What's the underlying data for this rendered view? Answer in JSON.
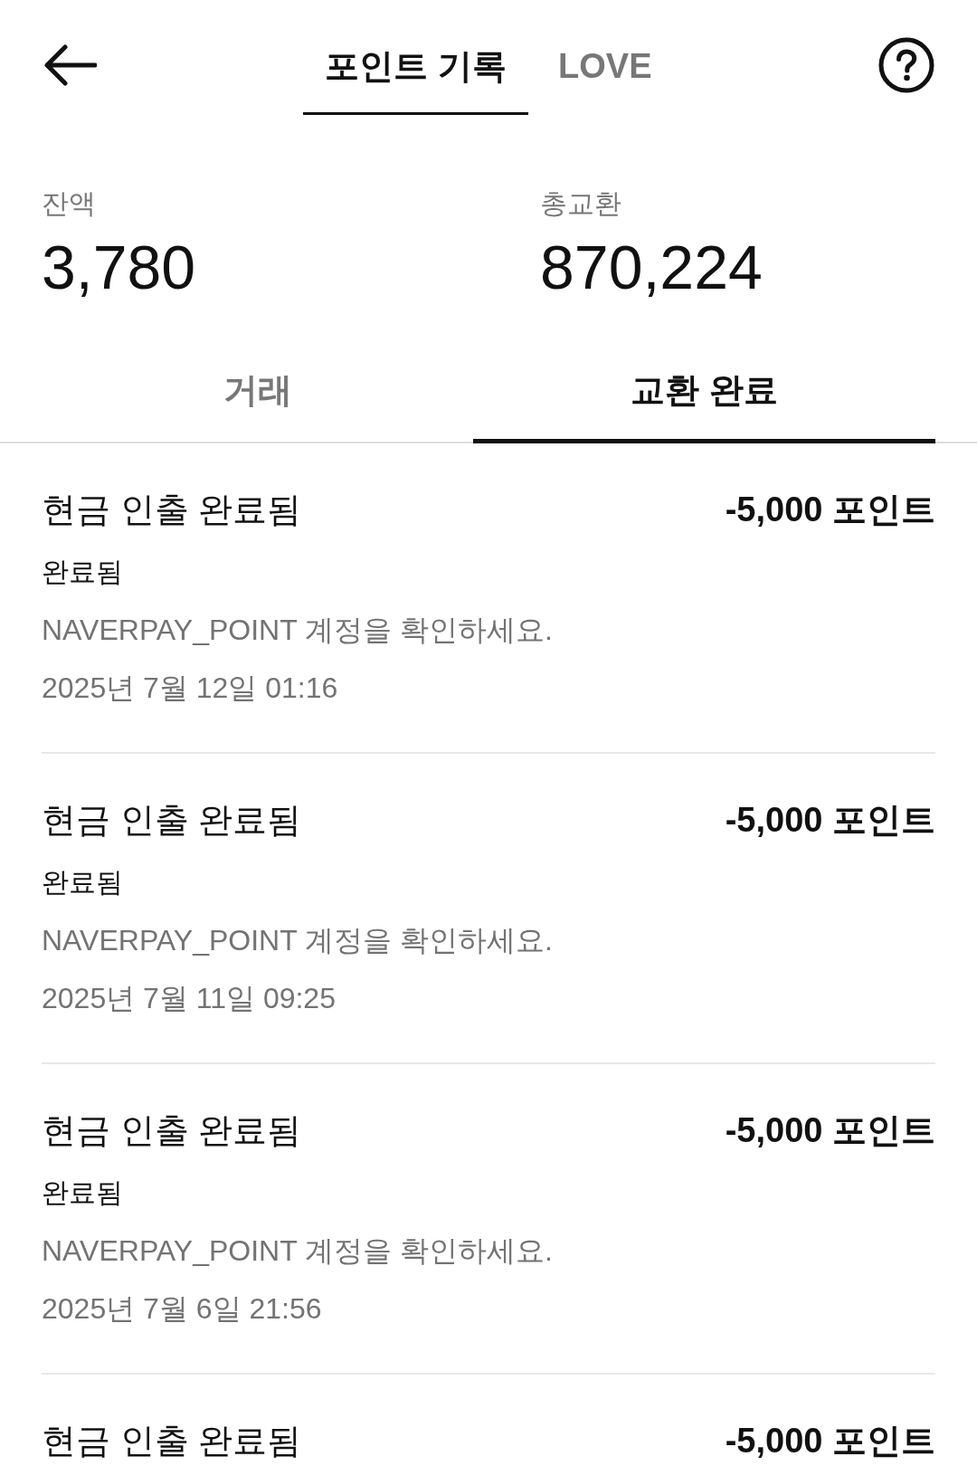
{
  "header": {
    "tabs": [
      {
        "label": "포인트 기록",
        "selected": true
      },
      {
        "label": "LOVE",
        "selected": false
      }
    ]
  },
  "summary": [
    {
      "label": "잔액",
      "value": "3,780"
    },
    {
      "label": "총교환",
      "value": "870,224"
    }
  ],
  "sub_tabs": [
    {
      "label": "거래",
      "selected": false
    },
    {
      "label": "교환 완료",
      "selected": true
    }
  ],
  "transactions": [
    {
      "title": "현금 인출 완료됨",
      "amount": "-5,000 포인트",
      "status": "완료됨",
      "note": "NAVERPAY_POINT 계정을 확인하세요.",
      "date": "2025년 7월 12일 01:16"
    },
    {
      "title": "현금 인출 완료됨",
      "amount": "-5,000 포인트",
      "status": "완료됨",
      "note": "NAVERPAY_POINT 계정을 확인하세요.",
      "date": "2025년 7월 11일 09:25"
    },
    {
      "title": "현금 인출 완료됨",
      "amount": "-5,000 포인트",
      "status": "완료됨",
      "note": "NAVERPAY_POINT 계정을 확인하세요.",
      "date": "2025년 7월 6일 21:56"
    },
    {
      "title": "현금 인출 완료됨",
      "amount": "-5,000 포인트"
    }
  ]
}
